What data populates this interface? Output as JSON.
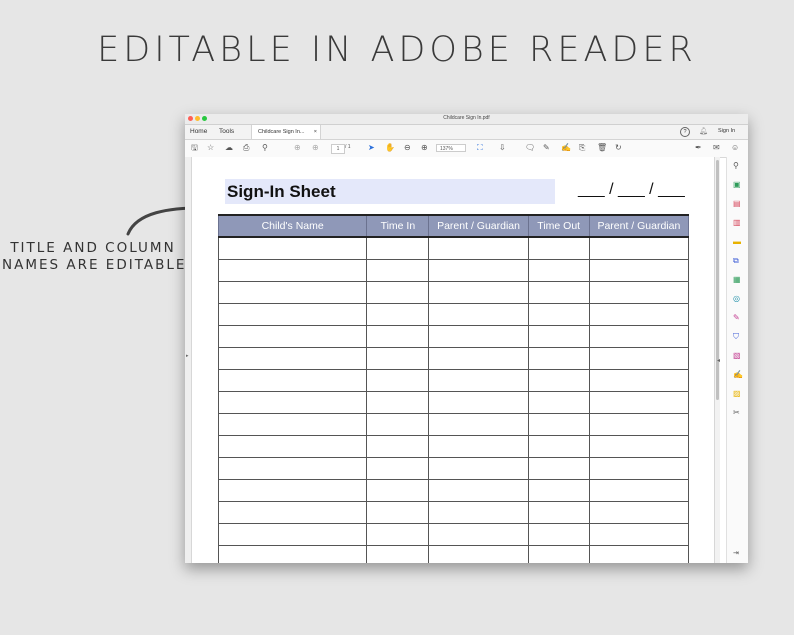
{
  "headline": "EDITABLE IN ADOBE READER",
  "callout": {
    "line1": "TITLE AND COLUMN",
    "line2": "NAMES ARE EDITABLE"
  },
  "window": {
    "title": "Childcare Sign In.pdf",
    "menu": {
      "home": "Home",
      "tools": "Tools"
    },
    "tab": {
      "label": "Childcare Sign In...",
      "close": "×"
    },
    "help_icon": "?",
    "sign_in": "Sign In",
    "toolbar": {
      "page_current": "1",
      "page_total": "/ 1",
      "zoom": "137%"
    }
  },
  "document": {
    "title": "Sign-In Sheet",
    "date_placeholder": "___ / ___ / ___",
    "columns": [
      "Child's Name",
      "Time In",
      "Parent / Guardian",
      "Time Out",
      "Parent / Guardian"
    ],
    "row_count": 15
  },
  "colors": {
    "header_fill": "#8f98b8",
    "title_field_fill": "#e4e8fa",
    "traffic_red": "#fe5f57",
    "traffic_yellow": "#febc2e",
    "traffic_green": "#28c840"
  }
}
